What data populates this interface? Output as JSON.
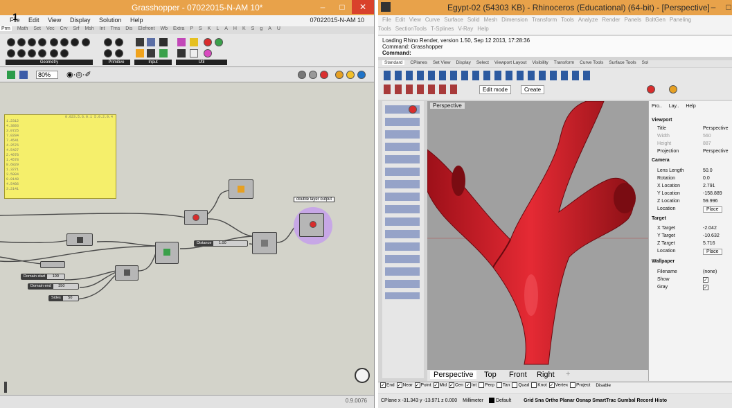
{
  "gh": {
    "title": "Grasshopper - 07022015-N-AM 10*",
    "file_label": "07022015-N-AM 10",
    "menu": [
      "File",
      "Edit",
      "View",
      "Display",
      "Solution",
      "Help"
    ],
    "tabs": [
      "Prm",
      "Math",
      "Set",
      "Vec",
      "Crv",
      "Srf",
      "Msh",
      "Int",
      "Trns",
      "Dis",
      "Elefront",
      "Wb",
      "Extra",
      "P",
      "S",
      "K",
      "L",
      "A",
      "H",
      "K",
      "S",
      "g",
      "A",
      "U"
    ],
    "groups": [
      "Geometry",
      "Primitive",
      "Input",
      "Util"
    ],
    "zoom": "80%",
    "text_panel_lines": [
      "1.2312",
      "4.3893",
      "3.0725",
      "7.0284",
      "7.4541",
      "4.2576",
      "4.5427",
      "2.4078",
      "1.4578",
      "8.6829",
      "1.3271",
      "3.5084",
      "9.0148",
      "4.5486",
      "3.2141"
    ],
    "text_panel_header": "0.023.5.6.0.1 5.0.2.0.4",
    "tooltip": "double layer output",
    "sliders": {
      "distance": {
        "label": "Distance",
        "value": "1.00"
      },
      "domain_start": {
        "label": "Domain start",
        "value": "100"
      },
      "domain_end": {
        "label": "Domain end",
        "value": "350"
      },
      "sides": {
        "label": "Sides",
        "value": "50"
      }
    },
    "version": "0.9.0076",
    "cursor_number": "1"
  },
  "rh": {
    "title": "Egypt-02 (54303 KB) - Rhinoceros (Educational) (64-bit) - [Perspective]",
    "menu": [
      "File",
      "Edit",
      "View",
      "Curve",
      "Surface",
      "Solid",
      "Mesh",
      "Dimension",
      "Transform",
      "Tools",
      "Analyze",
      "Render",
      "Panels",
      "BoltGen",
      "Paneling Tools",
      "SectionTools",
      "T-Splines",
      "V-Ray",
      "Help"
    ],
    "command_lines": [
      "Loading Rhino Render, version 1.50, Sep 12 2013, 17:28:36",
      "Command: Grasshopper",
      "Command:"
    ],
    "toolbar_tabs": [
      "Standard",
      "CPlanes",
      "Set View",
      "Display",
      "Select",
      "Viewport Layout",
      "Visibility",
      "Transform",
      "Curve Tools",
      "Surface Tools",
      "Sol"
    ],
    "edit_mode": "Edit mode",
    "create": "Create",
    "viewport_label": "Perspective",
    "view_tabs": [
      "Perspective",
      "Top",
      "Front",
      "Right"
    ],
    "props_tabs": [
      "Pro..",
      "Lay..",
      "Help"
    ],
    "props": {
      "viewport_head": "Viewport",
      "title_k": "Title",
      "title_v": "Perspective",
      "width_k": "Width",
      "width_v": "560",
      "height_k": "Height",
      "height_v": "887",
      "projection_k": "Projection",
      "projection_v": "Perspective",
      "camera_head": "Camera",
      "lens_k": "Lens Length",
      "lens_v": "50.0",
      "rotation_k": "Rotation",
      "rotation_v": "0.0",
      "xloc_k": "X Location",
      "xloc_v": "2.791",
      "yloc_k": "Y Location",
      "yloc_v": "-158.889",
      "zloc_k": "Z Location",
      "zloc_v": "59.996",
      "loc_k": "Location",
      "loc_v": "Place",
      "target_head": "Target",
      "xt_k": "X Target",
      "xt_v": "-2.042",
      "yt_k": "Y Target",
      "yt_v": "-10.632",
      "zt_k": "Z Target",
      "zt_v": "5.716",
      "tloc_k": "Location",
      "tloc_v": "Place",
      "wall_head": "Wallpaper",
      "fn_k": "Filename",
      "fn_v": "(none)",
      "show_k": "Show",
      "gray_k": "Gray"
    },
    "osnaps": [
      "End",
      "Near",
      "Point",
      "Mid",
      "Cen",
      "Int",
      "Perp",
      "Tan",
      "Quad",
      "Knot",
      "Vertex"
    ],
    "project": "Project",
    "disable": "Disable",
    "status": {
      "cplane": "CPlane x -31.343  y -13.971  z 0.000",
      "units": "Millimeter",
      "layer": "Default",
      "toggles": "Grid Sna  Ortho  Planar  Osnap  SmartTrac  Gumbal  Record Histo"
    },
    "colors": {
      "mesh": "#d8222b",
      "mesh_dark": "#8d1016",
      "viewport_bg": "#a0a0a0"
    }
  }
}
